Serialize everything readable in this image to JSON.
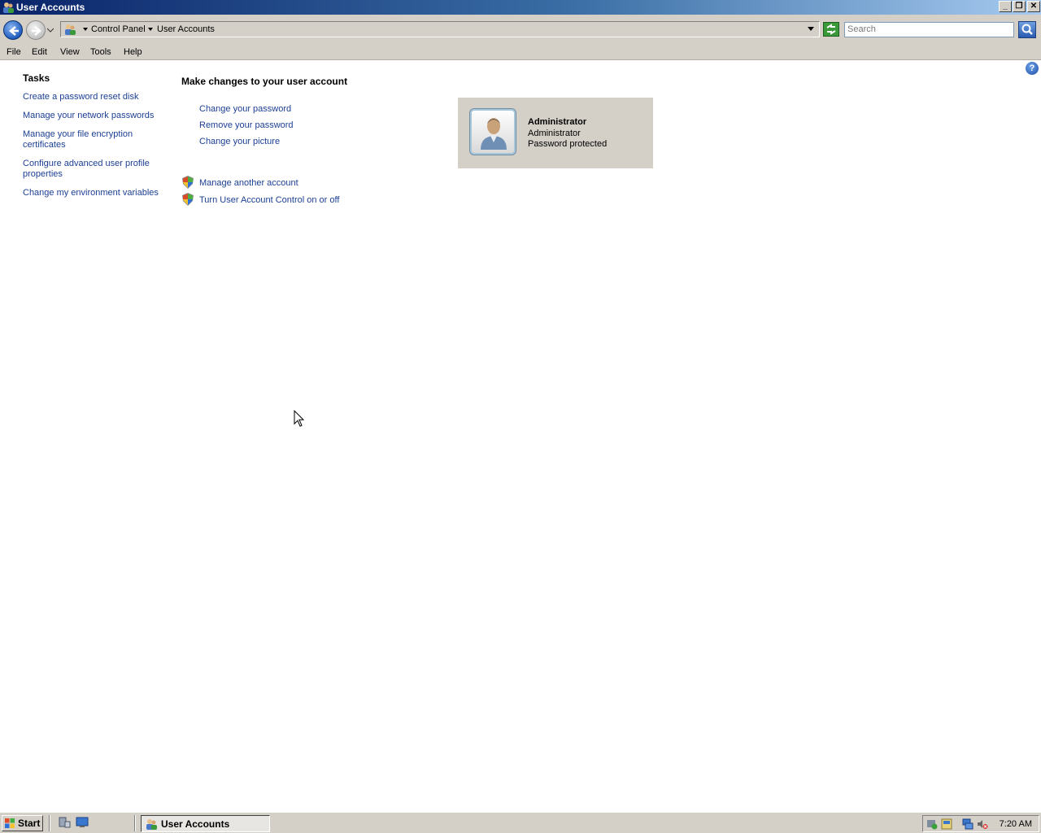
{
  "window": {
    "title": "User Accounts"
  },
  "address": {
    "crumbs": [
      "Control Panel",
      "User Accounts"
    ],
    "search_placeholder": "Search"
  },
  "menu": [
    "File",
    "Edit",
    "View",
    "Tools",
    "Help"
  ],
  "tasks": {
    "title": "Tasks",
    "links": [
      "Create a password reset disk",
      "Manage your network passwords",
      "Manage your file encryption certificates",
      "Configure advanced user profile properties",
      "Change my environment variables"
    ]
  },
  "main": {
    "title": "Make changes to your user account",
    "links": [
      "Change your password",
      "Remove your password",
      "Change your picture"
    ],
    "shield_links": [
      "Manage another account",
      "Turn User Account Control on or off"
    ]
  },
  "account": {
    "name": "Administrator",
    "type": "Administrator",
    "status": "Password protected"
  },
  "taskbar": {
    "start": "Start",
    "task": "User Accounts",
    "clock": "7:20 AM"
  },
  "icons": {
    "app": "user-accounts-icon",
    "back": "back-arrow-icon",
    "forward": "forward-arrow-icon",
    "refresh": "refresh-icon",
    "search": "search-icon",
    "help": "help-icon",
    "shield": "uac-shield-icon"
  }
}
